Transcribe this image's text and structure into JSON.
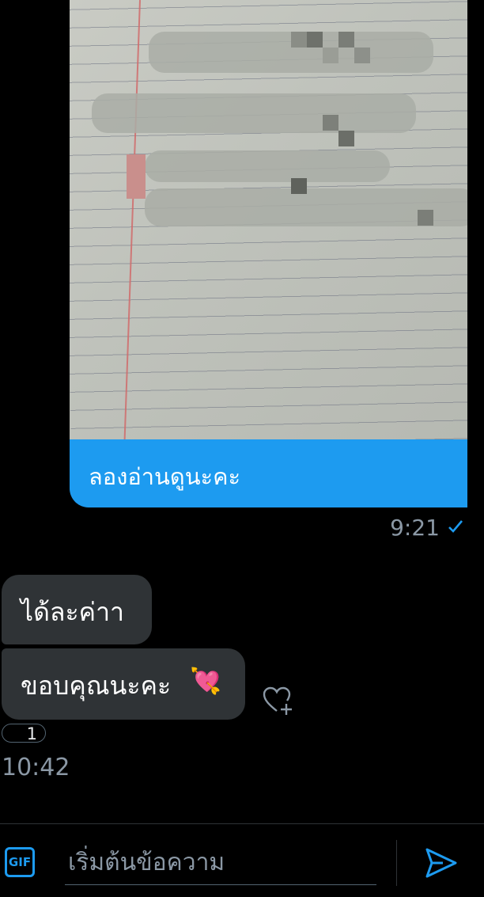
{
  "conversation": {
    "sent": {
      "image_name": "notebook-photo",
      "text": "ลองอ่านดูนะคะ",
      "time": "9:21",
      "status_icon": "check-icon"
    },
    "received": [
      {
        "text": "ได้ละค่าา"
      },
      {
        "text": "ขอบคุณนะคะ",
        "emoji": "💘"
      }
    ],
    "reaction": {
      "count": "1",
      "add_icon": "add-reaction-heart-icon"
    },
    "received_time": "10:42"
  },
  "composer": {
    "gif_label": "GIF",
    "placeholder": "เริ่มต้นข้อความ",
    "value": "",
    "send_icon": "send-icon"
  },
  "colors": {
    "accent": "#1d9bf0",
    "received_bubble": "#2f3336",
    "background": "#000000",
    "muted_text": "#8b98a5"
  }
}
